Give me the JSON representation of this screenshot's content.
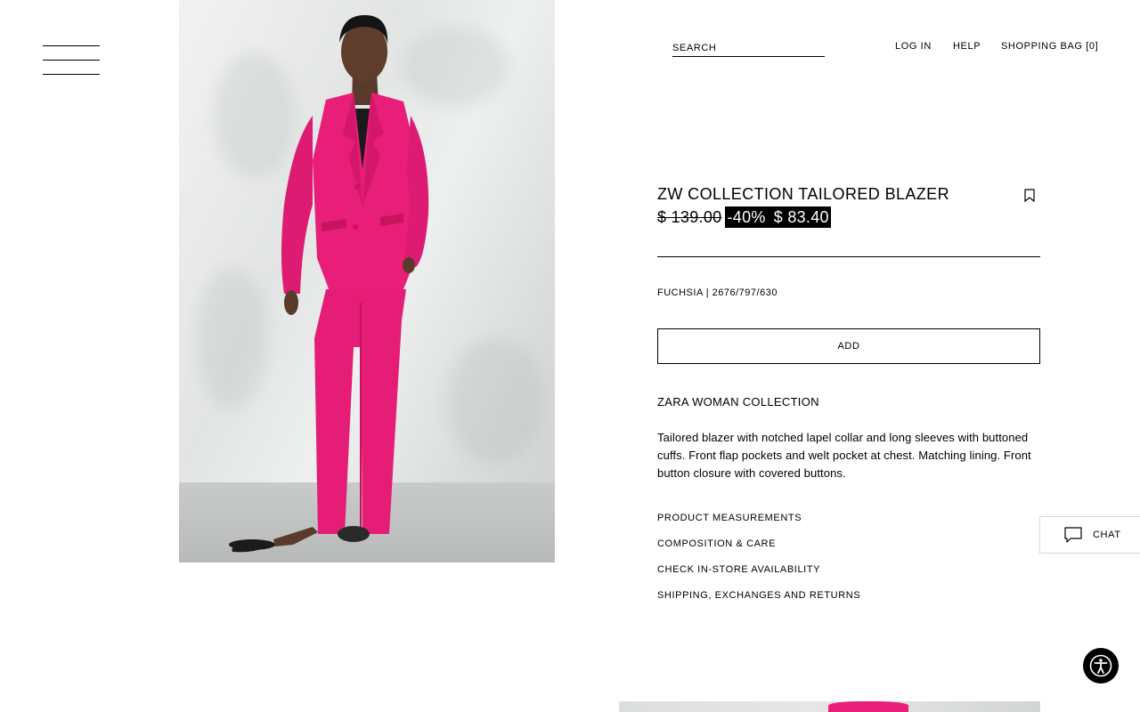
{
  "header": {
    "search_placeholder": "SEARCH",
    "login_label": "LOG IN",
    "help_label": "HELP",
    "bag_label": "SHOPPING BAG [0]"
  },
  "product": {
    "title": "ZW COLLECTION TAILORED BLAZER",
    "old_price": "$ 139.00",
    "discount": "-40%",
    "sale_price": "$ 83.40",
    "color_reference": "FUCHSIA | 2676/797/630",
    "add_label": "ADD",
    "collection": "ZARA WOMAN COLLECTION",
    "description": "Tailored blazer with notched lapel collar and long sleeves with buttoned cuffs. Front flap pockets and welt pocket at chest. Matching lining. Front button closure with covered buttons.",
    "links": {
      "measurements": "PRODUCT MEASUREMENTS",
      "composition": "COMPOSITION & CARE",
      "availability": "CHECK IN-STORE AVAILABILITY",
      "shipping": "SHIPPING, EXCHANGES AND RETURNS"
    }
  },
  "chat": {
    "label": "CHAT"
  },
  "icons": {
    "menu": "hamburger-menu-icon",
    "bookmark": "bookmark-icon",
    "chat": "chat-bubble-icon",
    "accessibility": "accessibility-icon"
  },
  "colors": {
    "product_fuchsia": "#e81e78",
    "sale_badge_bg": "#000000",
    "text": "#000000"
  }
}
